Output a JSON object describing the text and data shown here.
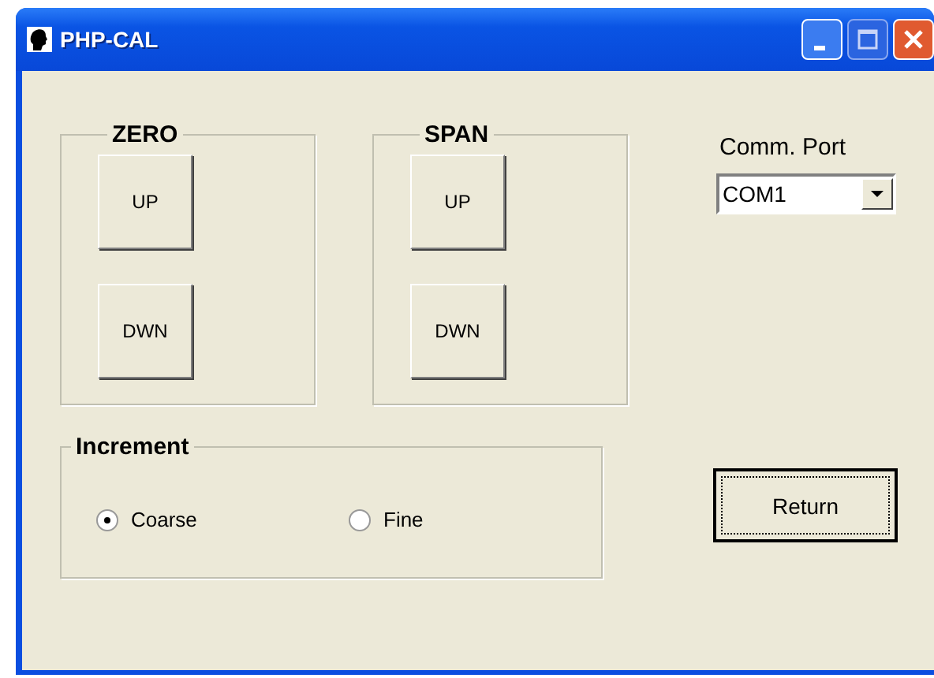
{
  "window": {
    "title": "PHP-CAL"
  },
  "groups": [
    {
      "legend": "ZERO",
      "buttons": [
        "UP",
        "DWN"
      ]
    },
    {
      "legend": "SPAN",
      "buttons": [
        "UP",
        "DWN"
      ]
    }
  ],
  "comm_port": {
    "label": "Comm. Port",
    "value": "COM1"
  },
  "increment": {
    "legend": "Increment",
    "options": [
      {
        "label": "Coarse",
        "selected": true
      },
      {
        "label": "Fine",
        "selected": false
      }
    ]
  },
  "return_button": "Return"
}
